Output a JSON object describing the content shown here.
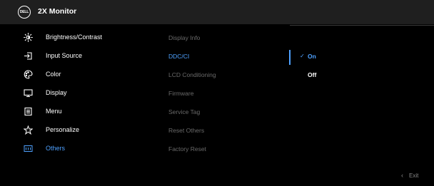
{
  "header": {
    "logo_text": "DELL",
    "title": "2X Monitor"
  },
  "menu": {
    "items": [
      {
        "label": "Brightness/Contrast",
        "icon": "brightness-icon"
      },
      {
        "label": "Input Source",
        "icon": "input-source-icon"
      },
      {
        "label": "Color",
        "icon": "color-palette-icon"
      },
      {
        "label": "Display",
        "icon": "display-icon"
      },
      {
        "label": "Menu",
        "icon": "menu-icon"
      },
      {
        "label": "Personalize",
        "icon": "star-icon"
      },
      {
        "label": "Others",
        "icon": "others-icon",
        "selected": true
      }
    ]
  },
  "submenu": {
    "items": [
      {
        "label": "Display Info"
      },
      {
        "label": "DDC/CI",
        "selected": true
      },
      {
        "label": "LCD Conditioning"
      },
      {
        "label": "Firmware"
      },
      {
        "label": "Service Tag"
      },
      {
        "label": "Reset Others"
      },
      {
        "label": "Factory Reset"
      }
    ]
  },
  "options": {
    "items": [
      {
        "label": "On",
        "selected": true
      },
      {
        "label": "Off"
      }
    ]
  },
  "footer": {
    "exit_label": "Exit"
  },
  "colors": {
    "accent": "#4ea1ff",
    "header_bg": "#1f1f1f",
    "background": "#000000"
  }
}
